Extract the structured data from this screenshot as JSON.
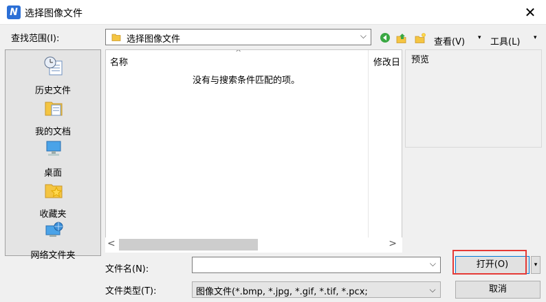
{
  "window": {
    "title": "选择图像文件",
    "close_glyph": "✕",
    "app_icon_glyph": "N"
  },
  "lookin": {
    "label": "查找范围(I):",
    "value": "选择图像文件",
    "arrow": "⌵"
  },
  "toolbar": {
    "back_glyph": "◀",
    "up_glyph": "▲",
    "new_folder_glyph": "✦",
    "view_label": "查看(V)",
    "view_drop": "▾",
    "tools_label": "工具(L)",
    "tools_drop": "▾"
  },
  "places": [
    {
      "label": "历史文件",
      "icon": "history-icon"
    },
    {
      "label": "我的文档",
      "icon": "documents-icon"
    },
    {
      "label": "桌面",
      "icon": "desktop-icon"
    },
    {
      "label": "收藏夹",
      "icon": "favorites-icon"
    },
    {
      "label": "网络文件夹",
      "icon": "network-folder-icon"
    }
  ],
  "filelist": {
    "col_name": "名称",
    "col_date": "修改日",
    "sort_caret": "^",
    "empty_message": "没有与搜索条件匹配的项。",
    "scroll_left": "<",
    "scroll_right": ">"
  },
  "preview": {
    "label": "预览"
  },
  "filename": {
    "label": "文件名(N):",
    "value": "",
    "arrow": "⌵"
  },
  "filetype": {
    "label": "文件类型(T):",
    "value": "图像文件(*.bmp, *.jpg, *.gif, *.tif, *.pcx;",
    "arrow": "⌵"
  },
  "buttons": {
    "open": "打开(O)",
    "open_drop": "▾",
    "cancel": "取消"
  },
  "colors": {
    "accent": "#0078d7",
    "highlight": "#e53935"
  }
}
